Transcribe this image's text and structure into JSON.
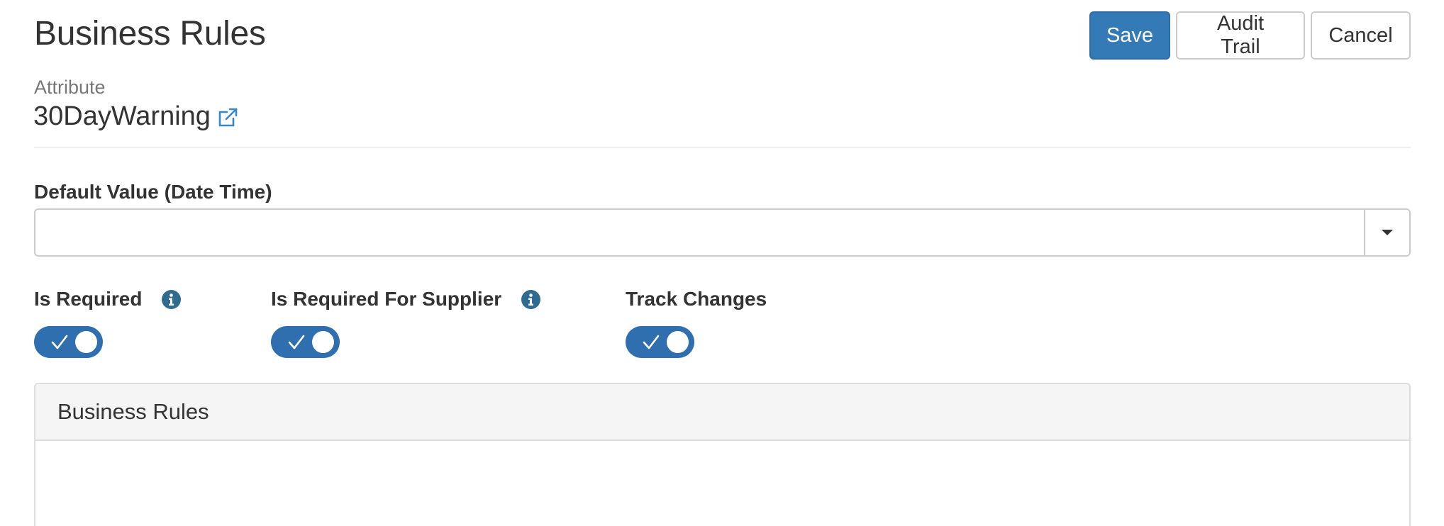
{
  "page": {
    "title": "Business Rules"
  },
  "toolbar": {
    "save_label": "Save",
    "audit_trail_label": "Audit Trail",
    "cancel_label": "Cancel"
  },
  "attribute": {
    "label": "Attribute",
    "value": "30DayWarning",
    "link_icon": "external-link-icon"
  },
  "default_value": {
    "label": "Default Value (Date Time)",
    "value": "",
    "placeholder": "",
    "dropdown_icon": "caret-down-icon"
  },
  "toggles": [
    {
      "label": "Is Required",
      "checked": true,
      "has_info": true
    },
    {
      "label": "Is Required For Supplier",
      "checked": true,
      "has_info": true
    },
    {
      "label": "Track Changes",
      "checked": true,
      "has_info": false
    }
  ],
  "panel": {
    "title": "Business Rules"
  },
  "colors": {
    "primary": "#337ab7",
    "toggle_on": "#2f6fb0",
    "info_icon": "#2e6b8f",
    "link": "#3a87c8"
  }
}
